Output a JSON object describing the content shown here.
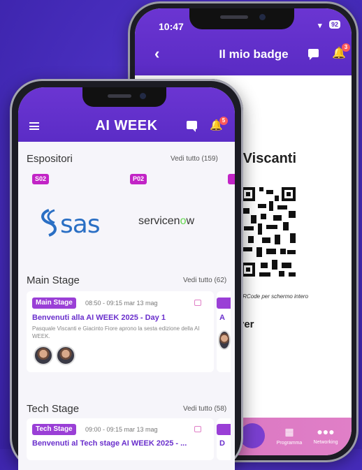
{
  "back_screen": {
    "status": {
      "time": "10:47",
      "battery": "92"
    },
    "title": "Il mio badge",
    "notification_count": "3",
    "name_fragment": "e Viscanti",
    "qr_caption": "QRCode per schermo intero",
    "sub_fragment": "yer",
    "tabs": [
      {
        "label": "Programma"
      },
      {
        "label": "Networking"
      }
    ]
  },
  "front_screen": {
    "app_title": "AI WEEK",
    "notification_count": "5",
    "exhibitors": {
      "title": "Espositori",
      "see_all": "Vedi tutto (159)",
      "items": [
        {
          "code": "S02",
          "logo": "sas"
        },
        {
          "code": "P02",
          "logo": "servicenow"
        }
      ]
    },
    "main_stage": {
      "title": "Main Stage",
      "see_all": "Vedi tutto (62)",
      "card": {
        "stage": "Main Stage",
        "time": "08:50 - 09:15 mar 13 mag",
        "title": "Benvenuti alla AI WEEK 2025 - Day 1",
        "description": "Pasquale Viscanti e Giacinto Fiore aprono la sesta edizione della AI WEEK.",
        "peek": "A"
      }
    },
    "tech_stage": {
      "title": "Tech Stage",
      "see_all": "Vedi tutto (58)",
      "card": {
        "stage": "Tech Stage",
        "time": "09:00 - 09:15 mar 13 mag",
        "title": "Benvenuti al Tech stage AI WEEK 2025 - ...",
        "peek": "D"
      }
    }
  },
  "colors": {
    "brand": "#5b2cc6",
    "accent": "#c224c6",
    "stage": "#9a3fd6"
  }
}
